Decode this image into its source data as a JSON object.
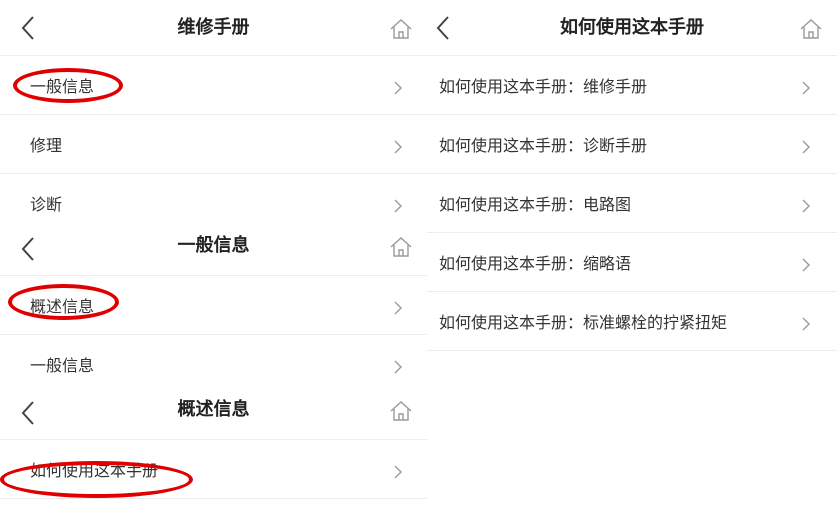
{
  "panel1": {
    "title": "维修手册",
    "items": [
      {
        "label": "一般信息"
      },
      {
        "label": "修理"
      },
      {
        "label": "诊断"
      }
    ]
  },
  "panel2": {
    "title": "一般信息",
    "items": [
      {
        "label": "概述信息"
      },
      {
        "label": "一般信息"
      }
    ]
  },
  "panel3": {
    "title": "概述信息",
    "items": [
      {
        "label": "如何使用这本手册"
      }
    ]
  },
  "panel4": {
    "title": "如何使用这本手册",
    "items": [
      {
        "label": "如何使用这本手册：维修手册"
      },
      {
        "label": "如何使用这本手册：诊断手册"
      },
      {
        "label": "如何使用这本手册：电路图"
      },
      {
        "label": "如何使用这本手册：缩略语"
      },
      {
        "label": "如何使用这本手册：标准螺栓的拧紧扭矩"
      }
    ]
  },
  "icons": {
    "back": "chevron-left-icon",
    "home": "home-icon",
    "row_arrow": "chevron-right-icon"
  },
  "colors": {
    "highlight_circle": "#e00000",
    "divider": "#ececec",
    "text": "#333333",
    "icon_gray": "#9a9a9a"
  }
}
